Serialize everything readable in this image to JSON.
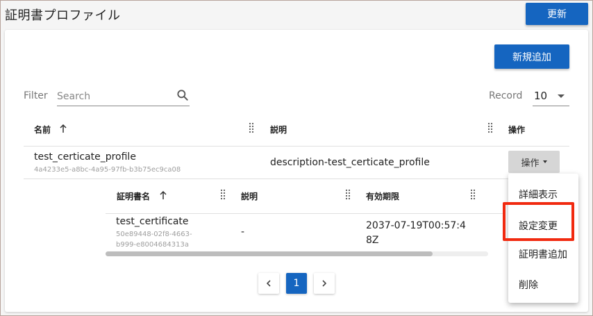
{
  "page": {
    "title": "証明書プロファイル",
    "refresh_label": "更新",
    "add_label": "新規追加"
  },
  "filter": {
    "label": "Filter",
    "placeholder": "Search"
  },
  "record": {
    "label": "Record",
    "value": "10"
  },
  "table": {
    "headers": {
      "name": "名前",
      "description": "説明",
      "actions": "操作"
    },
    "rows": [
      {
        "name": "test_certicate_profile",
        "id": "4a4233e5-a8bc-4a95-97fb-b3b75ec9ca08",
        "description": "description-test_certicate_profile",
        "action_label": "操作"
      }
    ]
  },
  "subtable": {
    "headers": {
      "cert_name": "証明書名",
      "description": "説明",
      "expiry": "有効期限"
    },
    "rows": [
      {
        "name": "test_certificate",
        "id_line1": "50e89448-02f8-4663-",
        "id_line2": "b999-e8004684313a",
        "description": "-",
        "expiry_line1": "2037-07-19T00:57:4",
        "expiry_line2": "8Z"
      }
    ]
  },
  "pagination": {
    "current": "1"
  },
  "menu": {
    "items": [
      "詳細表示",
      "設定変更",
      "証明書追加",
      "削除"
    ]
  },
  "colors": {
    "primary": "#1565c0",
    "highlight": "#f12a10"
  }
}
